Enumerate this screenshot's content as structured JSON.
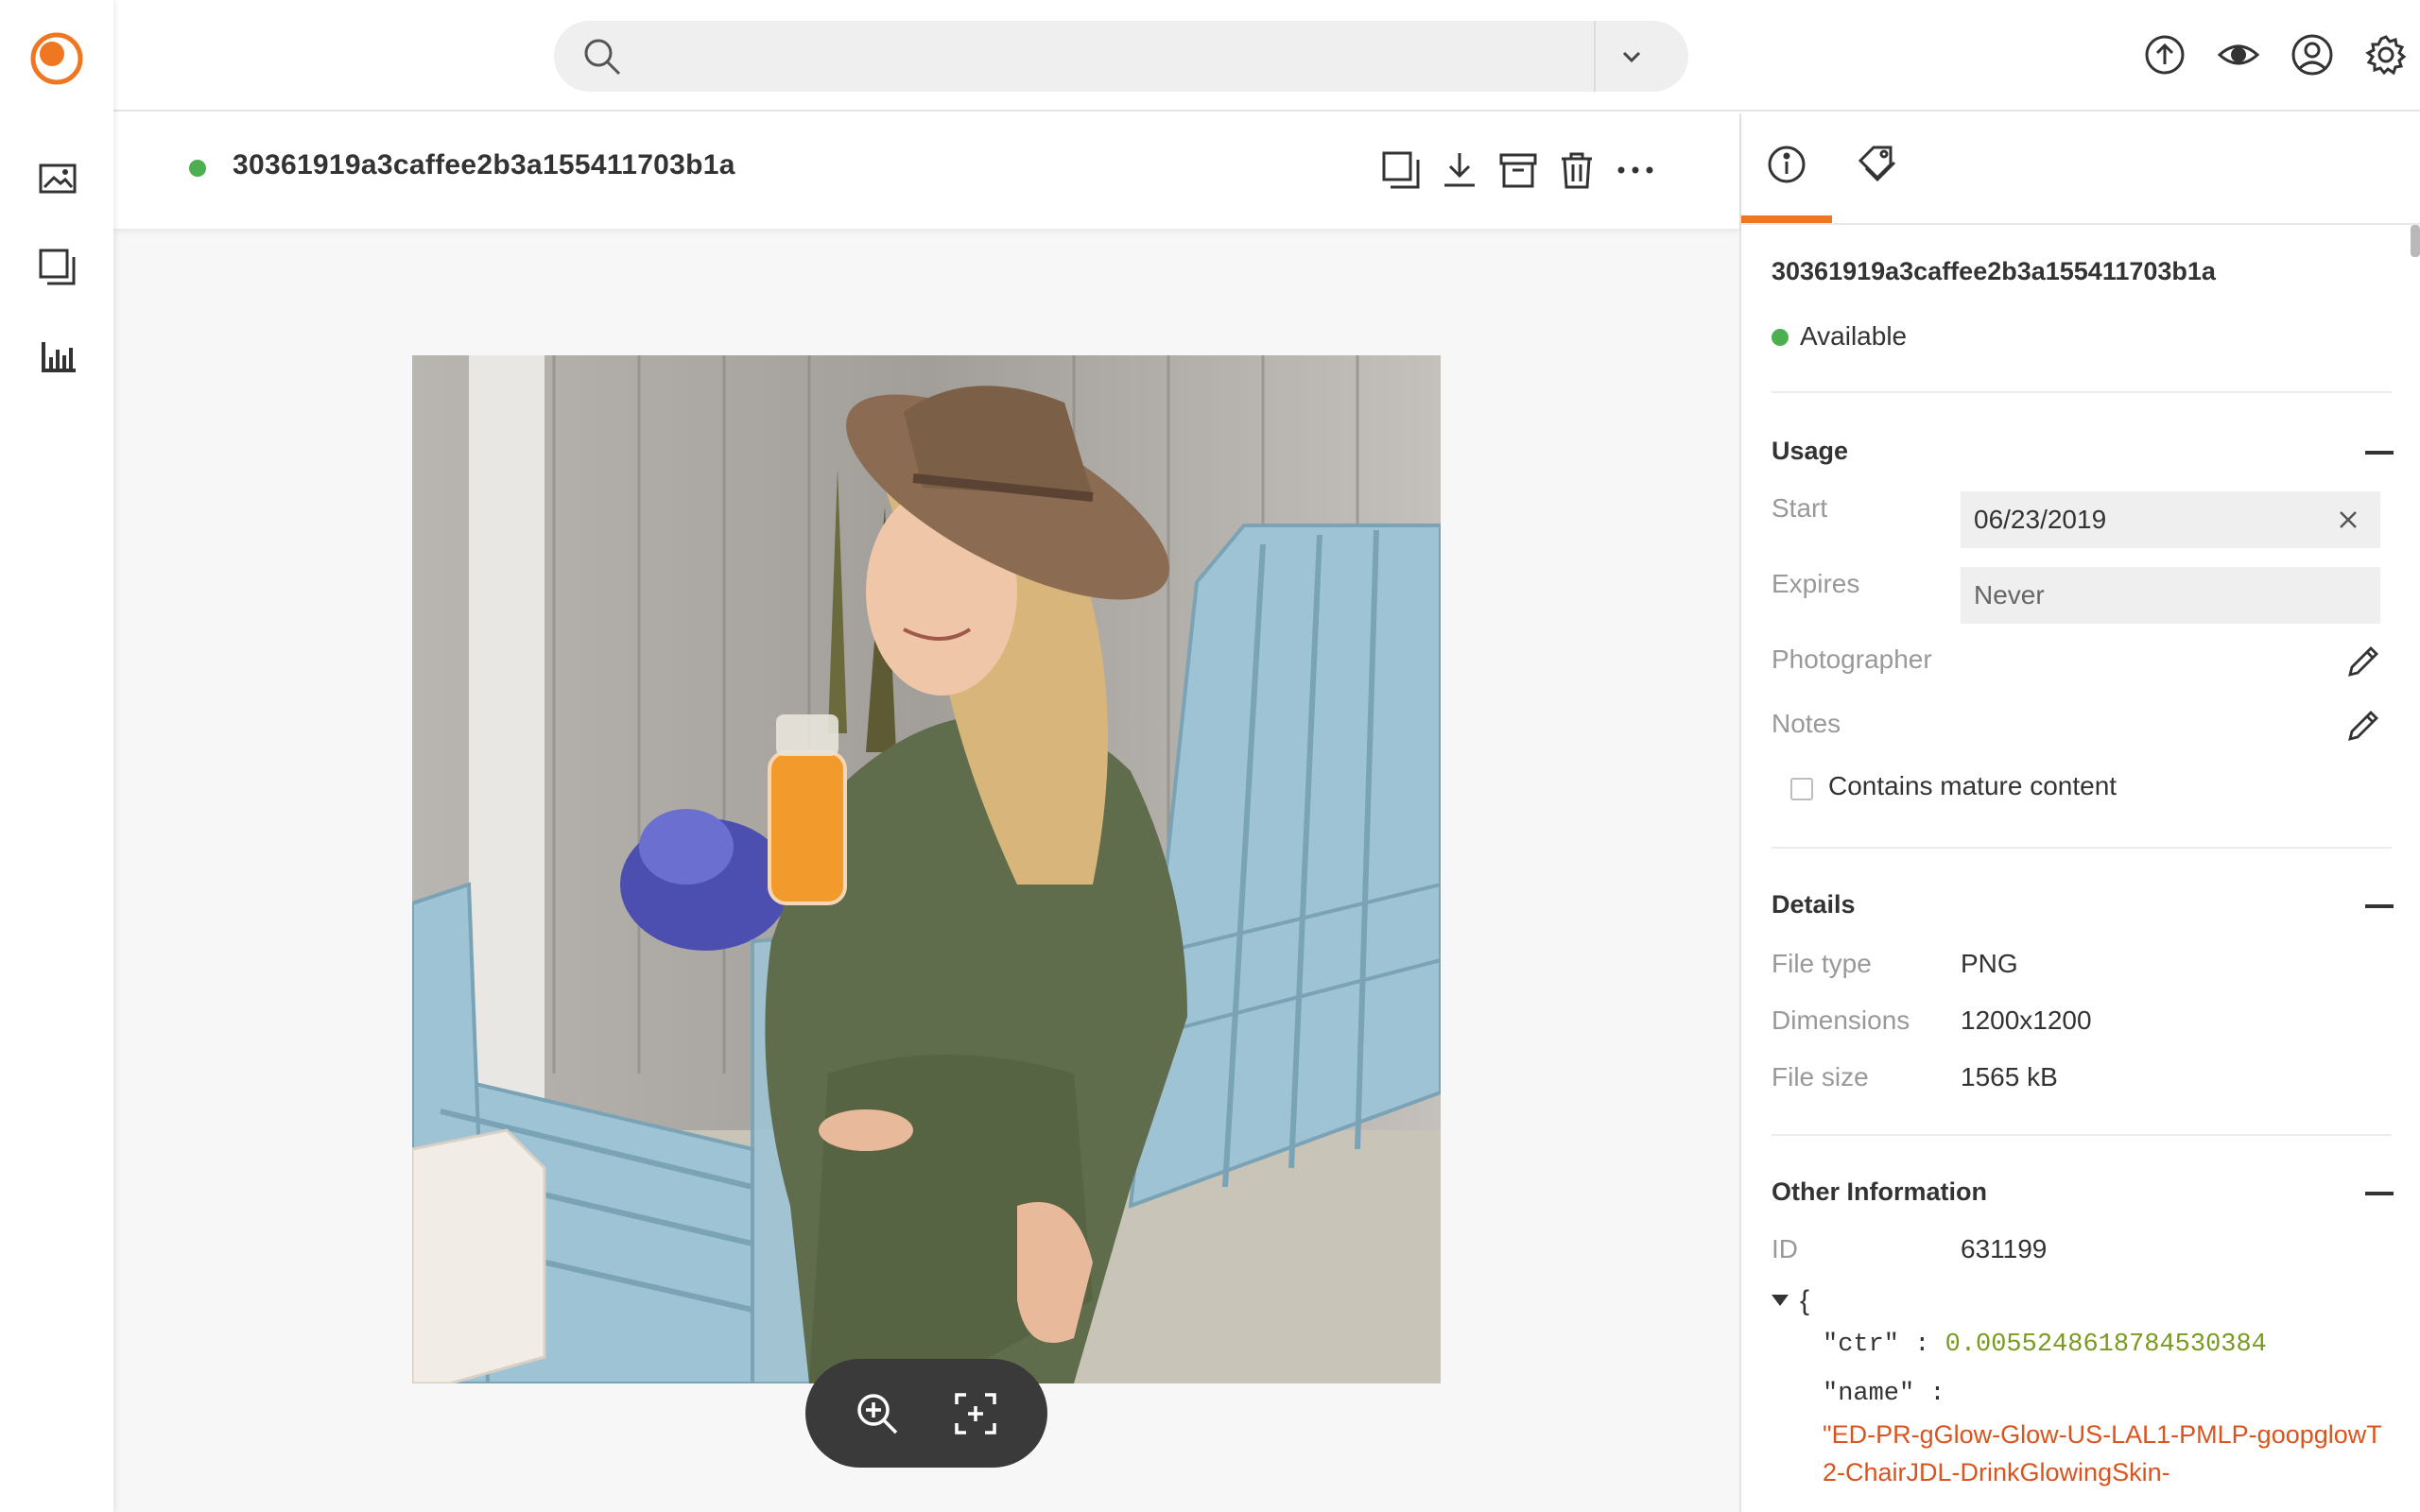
{
  "colors": {
    "accent": "#ef7722",
    "status_green": "#4caf50",
    "json_number": "#7a9a1f",
    "json_string": "#d9541e"
  },
  "rail": {
    "logo": "brand-logo",
    "items": [
      {
        "name": "images-icon"
      },
      {
        "name": "collections-icon"
      },
      {
        "name": "analytics-icon"
      }
    ]
  },
  "topbar": {
    "search": {
      "value": "",
      "placeholder": ""
    },
    "icons": [
      "upload-icon",
      "eye-icon",
      "account-icon",
      "settings-icon"
    ]
  },
  "asset": {
    "title": "30361919a3caffee2b3a155411703b1a",
    "actions": [
      "copy-icon",
      "download-icon",
      "archive-icon",
      "delete-icon",
      "more-icon"
    ]
  },
  "viewer": {
    "image": "photo of woman in hat with orange drink on adirondack chair",
    "controls": [
      "zoom-in-icon",
      "fit-screen-icon"
    ]
  },
  "panel": {
    "tabs": [
      "info-icon",
      "tags-icon"
    ],
    "asset_id": "30361919a3caffee2b3a155411703b1a",
    "status": "Available",
    "usage": {
      "heading": "Usage",
      "start_label": "Start",
      "start_value": "06/23/2019",
      "expires_label": "Expires",
      "expires_value": "Never",
      "photographer_label": "Photographer",
      "notes_label": "Notes",
      "mature_label": "Contains mature content"
    },
    "details": {
      "heading": "Details",
      "rows": [
        {
          "label": "File type",
          "value": "PNG"
        },
        {
          "label": "Dimensions",
          "value": "1200x1200"
        },
        {
          "label": "File size",
          "value": "1565 kB"
        }
      ]
    },
    "other": {
      "heading": "Other Information",
      "id_label": "ID",
      "id_value": "631199",
      "json_open": "{",
      "ctr_key": "\"ctr\"",
      "ctr_value": "0.0055248618784530384",
      "name_key": "\"name\"",
      "name_value": "\"ED-PR-gGlow-Glow-US-LAL1-PMLP-goopglowT2-ChairJDL-DrinkGlowingSkin-"
    }
  }
}
